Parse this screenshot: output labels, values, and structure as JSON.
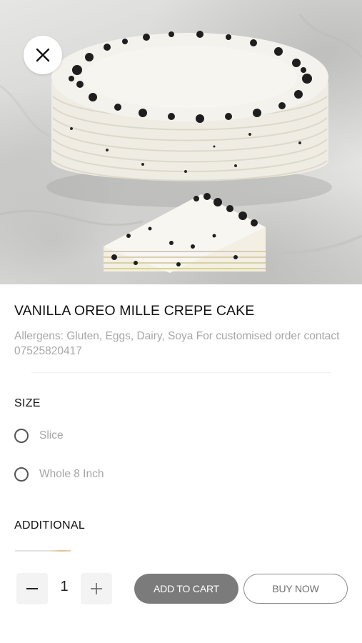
{
  "hero": {
    "image_alt": "cake-photo"
  },
  "close_button": {
    "icon": "close-icon"
  },
  "product": {
    "title": "VANILLA OREO MILLE CREPE CAKE",
    "description": "Allergens: Gluten, Eggs, Dairy, Soya For customised order contact 07525820417"
  },
  "size": {
    "label": "SIZE",
    "options": [
      {
        "label": "Slice",
        "selected": false
      },
      {
        "label": "Whole 8 Inch",
        "selected": false
      }
    ]
  },
  "additional": {
    "label": "ADDITIONAL"
  },
  "cart": {
    "minus_icon": "minus-icon",
    "plus_icon": "plus-icon",
    "quantity": "1",
    "add_to_cart_label": "ADD TO CART",
    "buy_now_label": "BUY NOW"
  },
  "colors": {
    "add_to_cart_bg": "#7b7b7b",
    "muted_text": "#a7a7a7",
    "primary_text": "#111111"
  }
}
